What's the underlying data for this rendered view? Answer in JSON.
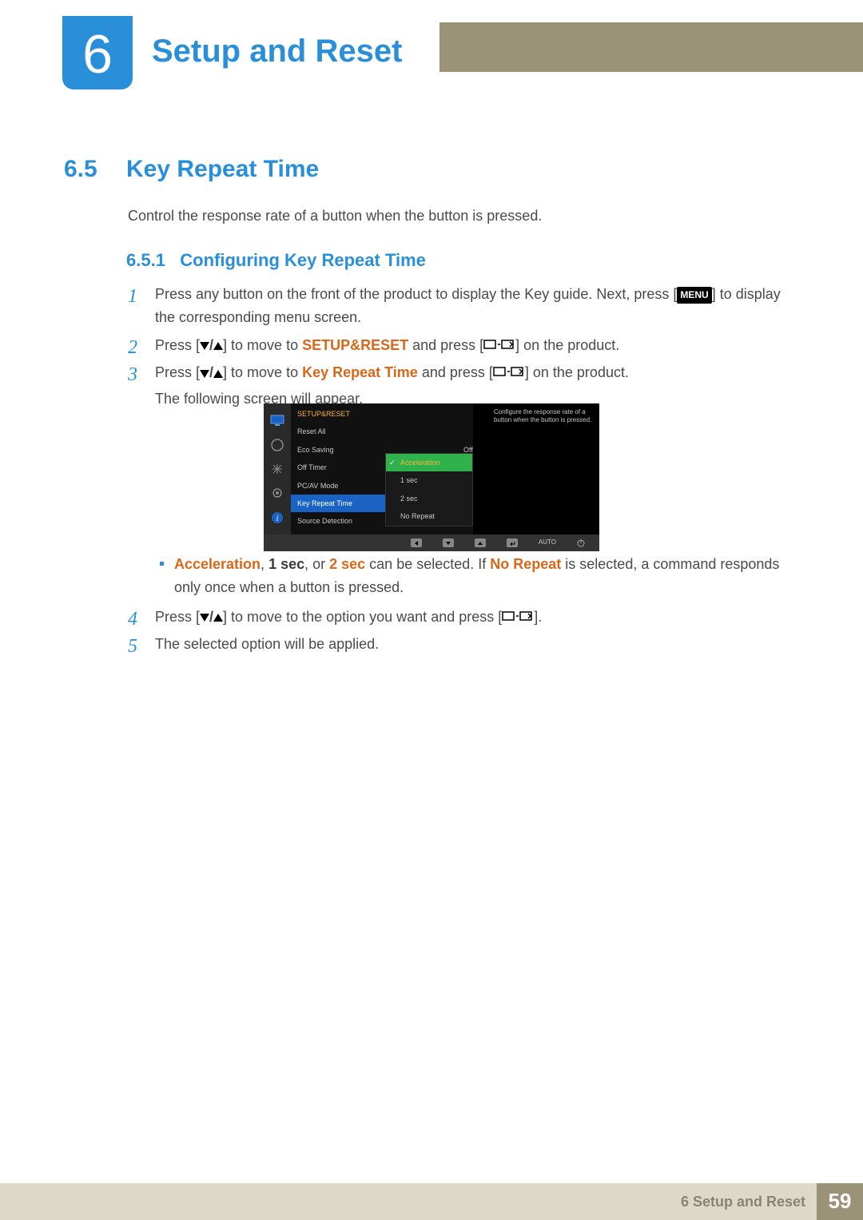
{
  "chapter": {
    "number": "6",
    "title": "Setup and Reset"
  },
  "section": {
    "number": "6.5",
    "title": "Key Repeat Time"
  },
  "intro": "Control the response rate of a button when the button is pressed.",
  "subsection": {
    "number": "6.5.1",
    "title": "Configuring Key Repeat Time"
  },
  "steps": {
    "s1": {
      "num": "1",
      "pre": "Press any button on the front of the product to display the Key guide. Next, press [",
      "menu": "MENU",
      "post": "] to display the corresponding menu screen."
    },
    "s2": {
      "num": "2",
      "pre": "Press [",
      "mid": "] to move to ",
      "target": "SETUP&RESET",
      "after": " and press [",
      "end": "] on the product."
    },
    "s3": {
      "num": "3",
      "pre": "Press [",
      "mid": "] to move to ",
      "target": "Key Repeat Time",
      "after": " and press [",
      "end": "] on the product.",
      "note": "The following screen will appear."
    },
    "s4": {
      "num": "4",
      "pre": "Press [",
      "mid": "] to move to the option you want and press [",
      "end": "]."
    },
    "s5": {
      "num": "5",
      "text": "The selected option will be applied."
    }
  },
  "bullet": {
    "a": "Acceleration",
    "b": "1 sec",
    "c": "2 sec",
    "mid1": ", ",
    "mid2": ", or ",
    "mid3": " can be selected. If ",
    "nr": "No Repeat",
    "tail": " is selected, a command responds only once when a button is pressed."
  },
  "osd": {
    "header": "SETUP&RESET",
    "items": [
      "Reset All",
      "Eco Saving",
      "Off Timer",
      "PC/AV Mode",
      "Key Repeat Time",
      "Source Detection"
    ],
    "eco_val": "Off",
    "submenu": [
      "Acceleration",
      "1 sec",
      "2 sec",
      "No Repeat"
    ],
    "desc": "Configure the response rate of a button when the button is pressed.",
    "navbar_auto": "AUTO"
  },
  "footer": {
    "chapter_label": "6 Setup and Reset",
    "page": "59"
  }
}
